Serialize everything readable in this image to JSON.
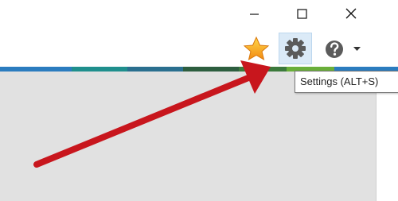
{
  "window_controls": {
    "minimize_icon": "minimize-icon",
    "maximize_icon": "maximize-icon",
    "close_icon": "close-icon"
  },
  "toolbar": {
    "favorites_icon": "star-icon",
    "settings_icon": "gear-icon",
    "help_icon": "question-icon",
    "help_dropdown_icon": "caret-down-icon"
  },
  "tooltip": {
    "text": "Settings (ALT+S)"
  },
  "annotation": {
    "arrow_color": "#c8161d"
  },
  "colors": {
    "stripe": [
      "#2b7cbf",
      "#1f8f8d",
      "#2a6f8f",
      "#2d5e3f",
      "#3c7a3c",
      "#6aaf3a",
      "#2b7cbf"
    ],
    "content_background": "#e1e1e1",
    "settings_hover": "#dbeaf7"
  }
}
